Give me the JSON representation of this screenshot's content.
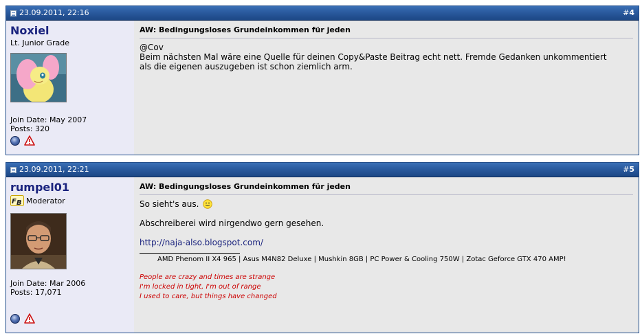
{
  "posts": [
    {
      "date": "23.09.2011, 22:16",
      "number_hash": "#",
      "number": "4",
      "username": "Noxiel",
      "usertitle": "Lt. Junior Grade",
      "join_date": "Join Date: May 2007",
      "posts": "Posts: 320",
      "title": "AW: Bedingungsloses Grundeinkommen für jeden",
      "lines": [
        "@Cov",
        "Beim nächsten Mal wäre eine Quelle für deinen Copy&Paste Beitrag echt nett. Fremde Gedanken unkommentiert",
        "als die eigenen auszugeben ist schon ziemlich arm."
      ]
    },
    {
      "date": "23.09.2011, 22:21",
      "number_hash": "#",
      "number": "5",
      "username": "rumpel01",
      "usertitle": "Moderator",
      "join_date": "Join Date: Mar 2006",
      "posts": "Posts: 17,071",
      "title": "AW: Bedingungsloses Grundeinkommen für jeden",
      "line1": "So sieht's aus.",
      "line2": "Abschreiberei wird nirgendwo gern gesehen.",
      "link": "http://naja-also.blogspot.com/",
      "sig_hardware": "AMD Phenom II X4 965 | Asus M4N82 Deluxe | Mushkin 8GB | PC Power & Cooling 750W | Zotac Geforce GTX 470 AMP!",
      "sig_quote": [
        "People are crazy and times are strange",
        "I'm locked in tight, I'm out of range",
        "I used to care, but things have changed"
      ]
    }
  ],
  "icons": {
    "status": "online-status-icon",
    "report": "report-warning-icon",
    "post": "post-document-icon",
    "smiley": "smiley-icon",
    "badge": "fb-moderator-badge-icon"
  },
  "colors": {
    "header": "#2a5a9e",
    "username": "#1a237e",
    "signature_quote": "#cc0000"
  }
}
